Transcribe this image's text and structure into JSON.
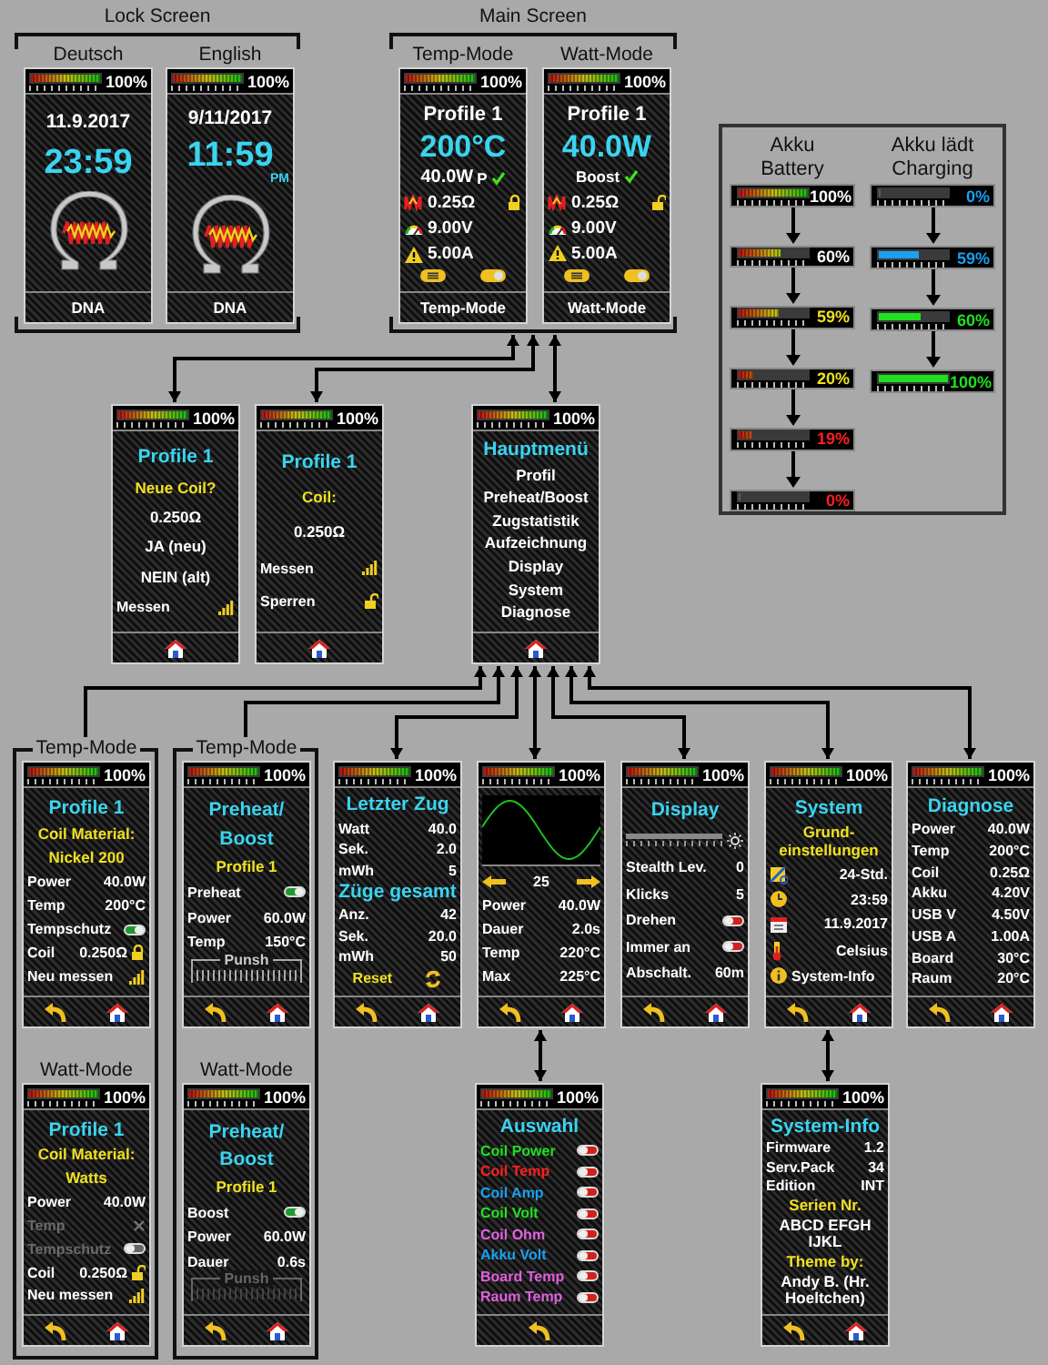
{
  "groups": [
    {
      "title": "Lock Screen"
    },
    {
      "title": "Main Screen"
    }
  ],
  "battery_panel": {
    "columns": [
      {
        "title": "Akku",
        "subtitle": "Battery",
        "gauges": [
          {
            "kind": "discharging",
            "percent": "100%",
            "level": 1
          },
          {
            "kind": "discharging",
            "percent": "60%",
            "level": 0.6
          },
          {
            "kind": "discharging",
            "percent": "59%",
            "level": 0.59
          },
          {
            "kind": "discharging",
            "percent": "20%",
            "level": 0.2
          },
          {
            "kind": "discharging",
            "percent": "19%",
            "level": 0.19
          },
          {
            "kind": "discharging",
            "percent": "0%",
            "level": 0
          }
        ]
      },
      {
        "title": "Akku lädt",
        "subtitle": "Charging",
        "gauges": [
          {
            "kind": "charging",
            "percent": "0%",
            "level": 0
          },
          {
            "kind": "charging",
            "percent": "59%",
            "level": 0.59
          },
          {
            "kind": "charging",
            "percent": "60%",
            "level": 0.6
          },
          {
            "kind": "charging",
            "percent": "100%",
            "level": 1
          }
        ]
      }
    ]
  },
  "screens": [
    {
      "caption": "Deutsch",
      "status": {
        "percent": "100%",
        "level": 1
      },
      "lines": [
        {
          "kind": "date",
          "text": "11.9.2017"
        },
        {
          "kind": "clock",
          "text": "23:59"
        },
        {
          "kind": "logo"
        }
      ],
      "footer": {
        "kind": "label",
        "text": "DNA"
      }
    },
    {
      "caption": "English",
      "status": {
        "percent": "100%",
        "level": 1
      },
      "lines": [
        {
          "kind": "date",
          "text": "9/11/2017"
        },
        {
          "kind": "clock",
          "text": "11:59"
        },
        {
          "kind": "suffix",
          "text": "PM"
        },
        {
          "kind": "logo"
        }
      ],
      "footer": {
        "kind": "label",
        "text": "DNA"
      }
    },
    {
      "caption": "Temp-Mode",
      "status": {
        "percent": "100%",
        "level": 1
      },
      "lines": [
        {
          "kind": "name",
          "text": "Profile 1"
        },
        {
          "kind": "big",
          "text": "200°C"
        },
        {
          "kind": "mode_line",
          "value": "40.0W",
          "flag": "P",
          "active": true
        },
        {
          "kind": "coil_row",
          "value": "0.25Ω",
          "locked": true
        },
        {
          "kind": "voltage_row",
          "value": "9.00V"
        },
        {
          "kind": "current_row",
          "value": "5.00A"
        },
        {
          "kind": "buttons"
        }
      ],
      "footer": {
        "kind": "label",
        "text": "Temp-Mode"
      }
    },
    {
      "caption": "Watt-Mode",
      "status": {
        "percent": "100%",
        "level": 1
      },
      "lines": [
        {
          "kind": "name",
          "text": "Profile 1"
        },
        {
          "kind": "big",
          "text": "40.0W"
        },
        {
          "kind": "mode_line",
          "flag": "Boost",
          "active": true
        },
        {
          "kind": "coil_row",
          "value": "0.25Ω",
          "locked": false
        },
        {
          "kind": "voltage_row",
          "value": "9.00V"
        },
        {
          "kind": "current_row",
          "value": "5.00A"
        },
        {
          "kind": "buttons"
        }
      ],
      "footer": {
        "kind": "label",
        "text": "Watt-Mode"
      }
    },
    {
      "status": {
        "percent": "100%",
        "level": 1
      },
      "lines": [
        {
          "kind": "title",
          "text": "Profile 1"
        },
        {
          "kind": "heading",
          "text": "Neue Coil?"
        },
        {
          "kind": "text",
          "text": "0.250Ω"
        },
        {
          "kind": "text",
          "text": "JA (neu)"
        },
        {
          "kind": "text",
          "text": "NEIN (alt)"
        },
        {
          "kind": "measure_row",
          "label": "Messen"
        }
      ],
      "footer": {
        "kind": "nav",
        "back": false,
        "home": true
      }
    },
    {
      "status": {
        "percent": "100%",
        "level": 1
      },
      "lines": [
        {
          "kind": "title",
          "text": "Profile 1"
        },
        {
          "kind": "heading",
          "text": "Coil:"
        },
        {
          "kind": "text",
          "text": "0.250Ω"
        },
        {
          "kind": "measure_row",
          "label": "Messen"
        },
        {
          "kind": "lock_row",
          "label": "Sperren",
          "locked": false
        }
      ],
      "footer": {
        "kind": "nav",
        "back": false,
        "home": true
      }
    },
    {
      "status": {
        "percent": "100%",
        "level": 1
      },
      "lines": [
        {
          "kind": "title",
          "text": "Hauptmenü"
        },
        {
          "kind": "text",
          "text": "Profil"
        },
        {
          "kind": "text",
          "text": "Preheat/Boost"
        },
        {
          "kind": "text",
          "text": "Zugstatistik"
        },
        {
          "kind": "text",
          "text": "Aufzeichnung"
        },
        {
          "kind": "text",
          "text": "Display"
        },
        {
          "kind": "text",
          "text": "System"
        },
        {
          "kind": "text",
          "text": "Diagnose"
        }
      ],
      "footer": {
        "kind": "nav",
        "back": false,
        "home": true
      }
    },
    {
      "caption": "Temp-Mode",
      "status": {
        "percent": "100%",
        "level": 1
      },
      "lines": [
        {
          "kind": "title",
          "text": "Profile 1"
        },
        {
          "kind": "heading",
          "text": "Coil Material:"
        },
        {
          "kind": "heading",
          "text": "Nickel 200"
        },
        {
          "kind": "row",
          "label": "Power",
          "value": "40.0W",
          "disabled": false
        },
        {
          "kind": "row",
          "label": "Temp",
          "value": "200°C",
          "disabled": false
        },
        {
          "kind": "toggle_row",
          "label": "Tempschutz",
          "on": true,
          "disabled": false
        },
        {
          "kind": "lock_row",
          "label": "Coil",
          "value": "0.250Ω",
          "locked": true
        },
        {
          "kind": "measure_row",
          "label": "Neu messen"
        }
      ],
      "footer": {
        "kind": "nav",
        "back": true,
        "home": true
      }
    },
    {
      "caption": "Temp-Mode",
      "status": {
        "percent": "100%",
        "level": 1
      },
      "lines": [
        {
          "kind": "title",
          "text": "Preheat/"
        },
        {
          "kind": "title",
          "text": "Boost"
        },
        {
          "kind": "heading",
          "text": "Profile 1"
        },
        {
          "kind": "toggle_row",
          "label": "Preheat",
          "on": true,
          "disabled": false
        },
        {
          "kind": "row",
          "label": "Power",
          "value": "60.0W",
          "disabled": false
        },
        {
          "kind": "row",
          "label": "Temp",
          "value": "150°C",
          "disabled": false
        },
        {
          "kind": "punch",
          "label": "Punsh",
          "disabled": false
        }
      ],
      "footer": {
        "kind": "nav",
        "back": true,
        "home": true
      }
    },
    {
      "status": {
        "percent": "100%",
        "level": 1
      },
      "lines": [
        {
          "kind": "title",
          "text": "Letzter Zug"
        },
        {
          "kind": "row",
          "label": "Watt",
          "value": "40.0",
          "disabled": false
        },
        {
          "kind": "row",
          "label": "Sek.",
          "value": "2.0",
          "disabled": false
        },
        {
          "kind": "row",
          "label": "mWh",
          "value": "5",
          "disabled": false
        },
        {
          "kind": "title",
          "text": "Züge gesamt"
        },
        {
          "kind": "row",
          "label": "Anz.",
          "value": "42",
          "disabled": false
        },
        {
          "kind": "row",
          "label": "Sek.",
          "value": "20.0",
          "disabled": false
        },
        {
          "kind": "row",
          "label": "mWh",
          "value": "50",
          "disabled": false
        },
        {
          "kind": "reset_row",
          "label": "Reset"
        }
      ],
      "footer": {
        "kind": "nav",
        "back": true,
        "home": true
      }
    },
    {
      "status": {
        "percent": "100%",
        "level": 1
      },
      "lines": [
        {
          "kind": "waveform"
        },
        {
          "kind": "stepper",
          "value": "25"
        },
        {
          "kind": "row",
          "label": "Power",
          "value": "40.0W",
          "disabled": false
        },
        {
          "kind": "row",
          "label": "Dauer",
          "value": "2.0s",
          "disabled": false
        },
        {
          "kind": "row",
          "label": "Temp",
          "value": "220°C",
          "disabled": false
        },
        {
          "kind": "row",
          "label": "Max",
          "value": "225°C",
          "disabled": false
        }
      ],
      "footer": {
        "kind": "nav",
        "back": true,
        "home": true
      }
    },
    {
      "status": {
        "percent": "100%",
        "level": 1
      },
      "lines": [
        {
          "kind": "title",
          "text": "Display"
        },
        {
          "kind": "brightness",
          "level": 1
        },
        {
          "kind": "row",
          "label": "Stealth Lev.",
          "value": "0",
          "disabled": false
        },
        {
          "kind": "row",
          "label": "Klicks",
          "value": "5",
          "disabled": false
        },
        {
          "kind": "toggle_row",
          "label": "Drehen",
          "on": false,
          "disabled": false
        },
        {
          "kind": "toggle_row",
          "label": "Immer an",
          "on": false,
          "disabled": false
        },
        {
          "kind": "row",
          "label": "Abschalt.",
          "value": "60m",
          "disabled": false
        }
      ],
      "footer": {
        "kind": "nav",
        "back": true,
        "home": true
      }
    },
    {
      "status": {
        "percent": "100%",
        "level": 1
      },
      "lines": [
        {
          "kind": "title",
          "text": "System"
        },
        {
          "kind": "heading",
          "text": "Grund-einstellungen"
        },
        {
          "kind": "flag_row",
          "value": "24-Std."
        },
        {
          "kind": "clock_row",
          "value": "23:59"
        },
        {
          "kind": "calendar_row",
          "value": "11.9.2017"
        },
        {
          "kind": "thermometer_row",
          "value": "Celsius"
        },
        {
          "kind": "info_row",
          "value": "System-Info"
        }
      ],
      "footer": {
        "kind": "nav",
        "back": true,
        "home": true
      }
    },
    {
      "status": {
        "percent": "100%",
        "level": 1
      },
      "lines": [
        {
          "kind": "title",
          "text": "Diagnose"
        },
        {
          "kind": "row",
          "label": "Power",
          "value": "40.0W",
          "disabled": false
        },
        {
          "kind": "row",
          "label": "Temp",
          "value": "200°C",
          "disabled": false
        },
        {
          "kind": "row",
          "label": "Coil",
          "value": "0.25Ω",
          "disabled": false
        },
        {
          "kind": "row",
          "label": "Akku",
          "value": "4.20V",
          "disabled": false
        },
        {
          "kind": "row",
          "label": "USB V",
          "value": "4.50V",
          "disabled": false
        },
        {
          "kind": "row",
          "label": "USB A",
          "value": "1.00A",
          "disabled": false
        },
        {
          "kind": "row",
          "label": "Board",
          "value": "30°C",
          "disabled": false
        },
        {
          "kind": "row",
          "label": "Raum",
          "value": "20°C",
          "disabled": false
        }
      ],
      "footer": {
        "kind": "nav",
        "back": true,
        "home": true
      }
    },
    {
      "caption": "Watt-Mode",
      "status": {
        "percent": "100%",
        "level": 1
      },
      "lines": [
        {
          "kind": "title",
          "text": "Profile 1"
        },
        {
          "kind": "heading",
          "text": "Coil Material:"
        },
        {
          "kind": "heading",
          "text": "Watts"
        },
        {
          "kind": "row",
          "label": "Power",
          "value": "40.0W",
          "disabled": false
        },
        {
          "kind": "unavailable_row",
          "label": "Temp"
        },
        {
          "kind": "toggle_row",
          "label": "Tempschutz",
          "on": false,
          "disabled": true
        },
        {
          "kind": "lock_row",
          "label": "Coil",
          "value": "0.250Ω",
          "locked": false
        },
        {
          "kind": "measure_row",
          "label": "Neu messen"
        }
      ],
      "footer": {
        "kind": "nav",
        "back": true,
        "home": true
      }
    },
    {
      "caption": "Watt-Mode",
      "status": {
        "percent": "100%",
        "level": 1
      },
      "lines": [
        {
          "kind": "title",
          "text": "Preheat/"
        },
        {
          "kind": "title",
          "text": "Boost"
        },
        {
          "kind": "heading",
          "text": "Profile 1"
        },
        {
          "kind": "toggle_row",
          "label": "Boost",
          "on": true,
          "disabled": false
        },
        {
          "kind": "row",
          "label": "Power",
          "value": "60.0W",
          "disabled": false
        },
        {
          "kind": "row",
          "label": "Dauer",
          "value": "0.6s",
          "disabled": false
        },
        {
          "kind": "punch",
          "label": "Punsh",
          "disabled": true
        }
      ],
      "footer": {
        "kind": "nav",
        "back": true,
        "home": true
      }
    },
    {
      "status": {
        "percent": "100%",
        "level": 1
      },
      "lines": [
        {
          "kind": "title",
          "text": "Auswahl"
        },
        {
          "kind": "select_row",
          "label": "Coil Power",
          "color": "#20e020",
          "on": false
        },
        {
          "kind": "select_row",
          "label": "Coil Temp",
          "color": "#ff2020",
          "on": false
        },
        {
          "kind": "select_row",
          "label": "Coil Amp",
          "color": "#1aa0f0",
          "on": false
        },
        {
          "kind": "select_row",
          "label": "Coil Volt",
          "color": "#20e020",
          "on": false
        },
        {
          "kind": "select_row",
          "label": "Coil Ohm",
          "color": "#e060e0",
          "on": false
        },
        {
          "kind": "select_row",
          "label": "Akku Volt",
          "color": "#1aa0f0",
          "on": false
        },
        {
          "kind": "select_row",
          "label": "Board Temp",
          "color": "#e060e0",
          "on": false
        },
        {
          "kind": "select_row",
          "label": "Raum Temp",
          "color": "#e060e0",
          "on": false
        }
      ],
      "footer": {
        "kind": "nav",
        "back": true,
        "home": false
      }
    },
    {
      "status": {
        "percent": "100%",
        "level": 1
      },
      "lines": [
        {
          "kind": "title",
          "text": "System-Info"
        },
        {
          "kind": "row",
          "label": "Firmware",
          "value": "1.2",
          "disabled": false
        },
        {
          "kind": "row",
          "label": "Serv.Pack",
          "value": "34",
          "disabled": false
        },
        {
          "kind": "row",
          "label": "Edition",
          "value": "INT",
          "disabled": false
        },
        {
          "kind": "heading",
          "text": "Serien Nr."
        },
        {
          "kind": "text",
          "text": "ABCD EFGH IJKL"
        },
        {
          "kind": "heading",
          "text": "Theme by:"
        },
        {
          "kind": "text",
          "text": "Andy B. (Hr. Hoeltchen)"
        }
      ],
      "footer": {
        "kind": "nav",
        "back": true,
        "home": true
      }
    }
  ]
}
